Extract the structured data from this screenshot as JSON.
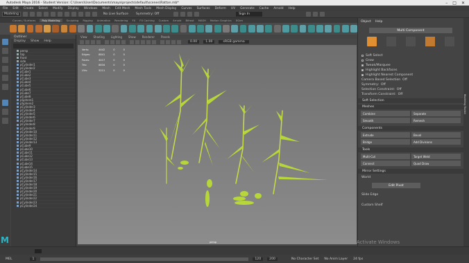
{
  "titlebar": {
    "title": "Autodesk Maya 2016 - Student Version: C:\\Users\\User\\Documents\\maya\\projects\\default\\scenes\\Rattan.mb*",
    "min": "–",
    "max": "□",
    "close": "✕"
  },
  "menubar": {
    "items": [
      "File",
      "Edit",
      "Create",
      "Select",
      "Modify",
      "Display",
      "Windows",
      "Mesh",
      "Edit Mesh",
      "Mesh Tools",
      "Mesh Display",
      "Curves",
      "Surfaces",
      "Deform",
      "UV",
      "Generate",
      "Cache",
      "Arnold",
      "Help"
    ]
  },
  "status": {
    "mode": "Modeling",
    "symmetry": "Symmetry: Off",
    "no_live": "No Live Surface",
    "signin": "Sign In"
  },
  "shelf": {
    "tabs": [
      "Curves / Surfaces",
      "Poly Modeling",
      "Sculpting",
      "Rigging",
      "Animation",
      "Rendering",
      "FX",
      "FX Caching",
      "Custom",
      "Arnold",
      "Bifrost",
      "MASH",
      "Motion Graphics",
      "XGen"
    ],
    "active": "Poly Modeling",
    "colors": [
      "#c8782f",
      "#d08a3a",
      "#c06a2a",
      "#b86b32",
      "#d49a4a",
      "#a85e2a",
      "#c9853b",
      "#c06a2a",
      "#7a7a7a",
      "#5fa0a8",
      "#3c8c8c",
      "#4d9aa0",
      "#6a6a6a",
      "#5fa0a8",
      "#3c8c8c",
      "#4d9aa0",
      "#4d9aa0",
      "#5fa0a8",
      "#3c8c8c",
      "#3c8c8c",
      "#6a6a6a",
      "#4d9aa0",
      "#3c8c8c",
      "#5fa0a8",
      "#3c8c8c",
      "#7a7a7a",
      "#5fa0a8",
      "#3c8c8c",
      "#4d9aa0",
      "#5fa0a8",
      "#3c8c8c",
      "#6a6a6a",
      "#4d9aa0",
      "#3c8c8c",
      "#5fa0a8",
      "#3c8c8c",
      "#4d9aa0",
      "#5fa0a8",
      "#3c8c8c",
      "#4d9aa0",
      "#5fa0a8"
    ]
  },
  "outliner": {
    "title": "Outliner",
    "menu": [
      "Display",
      "Show",
      "Help"
    ],
    "items": [
      "persp",
      "top",
      "front",
      "side",
      "pCylinder1",
      "pCylinder2",
      "pCube1",
      "pCube2",
      "pCube3",
      "pCube4",
      "pCube5",
      "pCube6",
      "pCube7",
      "pCube8",
      "pSphere1",
      "pSphere2",
      "pCylinder3",
      "pCylinder4",
      "pCylinder5",
      "pCylinder6",
      "pCylinder7",
      "pCylinder8",
      "pCylinder9",
      "pCylinder10",
      "pCylinder11",
      "pCylinder12",
      "pCylinder13",
      "pCube9",
      "pCube10",
      "pCube11",
      "pCube12",
      "pCube13",
      "pCube14",
      "pCube15",
      "pCylinder14",
      "pCylinder15",
      "pCylinder16",
      "pCylinder17",
      "pCylinder18",
      "pCylinder19",
      "pCylinder20",
      "pCylinder21",
      "pCylinder22",
      "pCylinder23",
      "pCylinder24"
    ]
  },
  "viewport": {
    "menu": [
      "View",
      "Shading",
      "Lighting",
      "Show",
      "Renderer",
      "Panels"
    ],
    "hud": [
      [
        "Verts:",
        "4442",
        "0",
        "0"
      ],
      [
        "Edges:",
        "8841",
        "0",
        "0"
      ],
      [
        "Faces:",
        "4417",
        "0",
        "0"
      ],
      [
        "Tris:",
        "8834",
        "0",
        "0"
      ],
      [
        "UVs:",
        "5211",
        "0",
        "0"
      ]
    ],
    "persp": "persp",
    "colorspace": "sRGB gamma",
    "val1": "0.00",
    "val2": "1.00"
  },
  "right": {
    "tabs": [
      "Object",
      "Help"
    ],
    "multi": "Multi Component",
    "opts": [
      "Soft Select",
      "Grow",
      "Tweak/Marquee",
      "Highlight Backfaces",
      "Highlight Nearest Component"
    ],
    "opts_on": [
      false,
      false,
      true,
      true,
      true
    ],
    "camera_sel": "Camera Based Selection",
    "camera_val": "Off",
    "symmetry": "Symmetry:",
    "symmetry_val": "Off",
    "sel_constraint": "Selection Constraint:",
    "sel_val": "Off",
    "transform_constraint": "Transform Constraint:",
    "transform_val": "Off",
    "soft_sel": "Soft Selection",
    "mesh_sec": "Meshes",
    "mesh_btns": [
      "Combine",
      "Separate",
      "Smooth",
      "Remesh"
    ],
    "comp_sec": "Components",
    "comp_btns": [
      "Extrude",
      "Bevel",
      "Bridge",
      "Add Divisions"
    ],
    "tools_sec": "Tools",
    "tools_btns": [
      "Multi-Cut",
      "Target Weld",
      "Connect",
      "Quad Draw"
    ],
    "mirror_sec": "Mirror Settings",
    "mirror_val": "World",
    "edit_pivot": "Edit Pivot",
    "slide_label": "Slide Edge",
    "custom": "Custom Shelf",
    "vertical_tab": "Modeling Toolkit"
  },
  "bottom": {
    "frames": [
      "1",
      "120",
      "200"
    ],
    "no_char": "No Character Set",
    "no_anim": "No Anim Layer",
    "mel": "MEL",
    "fps": "24 fps",
    "watermark": "Activate Windows"
  }
}
